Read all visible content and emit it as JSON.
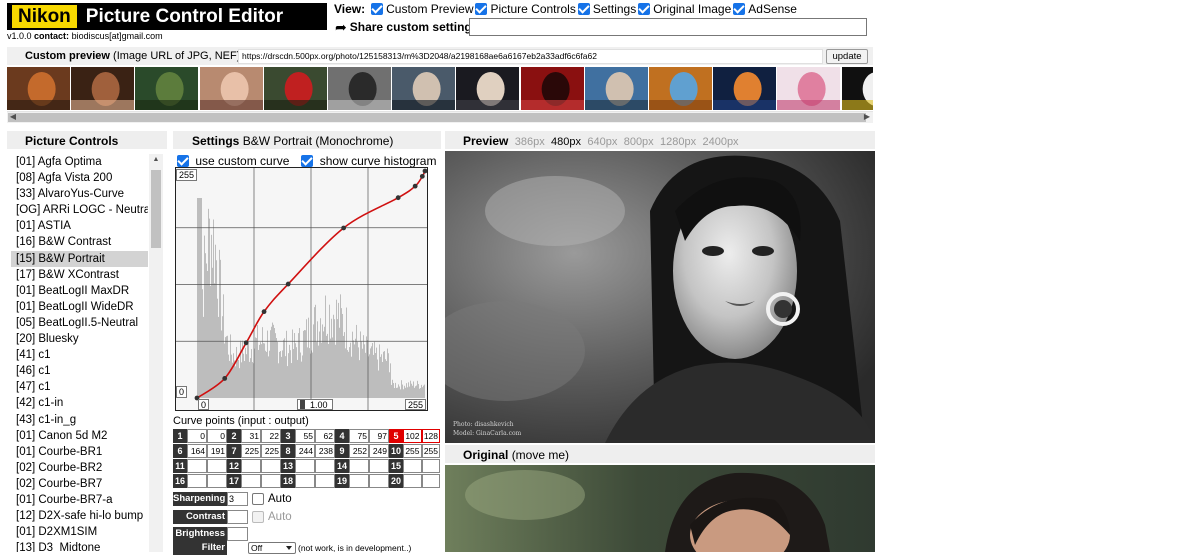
{
  "app": {
    "brand": "Nikon",
    "title": "Picture Control Editor",
    "version": "v1.0.0",
    "contact_label": "contact:",
    "contact": "biodiscus[at]gmail.com"
  },
  "view": {
    "label": "View:",
    "options": [
      {
        "label": "Custom Preview",
        "checked": true
      },
      {
        "label": "Picture Controls",
        "checked": true
      },
      {
        "label": "Settings",
        "checked": true
      },
      {
        "label": "Original Image",
        "checked": true
      },
      {
        "label": "AdSense",
        "checked": true
      }
    ],
    "share_label": "Share custom settings",
    "share_value": ""
  },
  "custom_preview": {
    "title": "Custom preview",
    "hint": "(Image URL of JPG, NEF)",
    "url": "https://drscdn.500px.org/photo/125158313/m%3D2048/a2198168ae6a6167eb2a33adf6c6fa62",
    "update_label": "update"
  },
  "picture_controls": {
    "title": "Picture Controls",
    "items": [
      "[01] Agfa Optima",
      "[08] Agfa Vista 200",
      "[33] AlvaroYus-Curve",
      "[OG] ARRi LOGC - Neutral",
      "[01] ASTIA",
      "[16] B&W Contrast",
      "[15] B&W Portrait",
      "[17] B&W XContrast",
      "[01] BeatLogII MaxDR",
      "[01] BeatLogII WideDR",
      "[05] BeatLogII.5-Neutral",
      "[20] Bluesky",
      "[41] c1",
      "[46] c1",
      "[47] c1",
      "[42] c1-in",
      "[43] c1-in_g",
      "[01] Canon 5d M2",
      "[01] Courbe-BR1",
      "[02] Courbe-BR2",
      "[02] Courbe-BR7",
      "[01] Courbe-BR7-a",
      "[12] D2X-safe hi-lo bump",
      "[01] D2XM1SIM",
      "[13] D3_Midtone"
    ],
    "selected_index": 6
  },
  "settings": {
    "title": "Settings",
    "profile": "B&W Portrait",
    "profile_type": "(Monochrome)",
    "use_custom_curve": "use custom curve",
    "show_histogram": "show curve histogram",
    "label_max": "255",
    "label_min": "0",
    "input_min": "0",
    "gamma": "1.00",
    "input_max": "255",
    "curve_points_title": "Curve points (input : output)",
    "points": [
      {
        "n": "1",
        "in": "0",
        "out": "0"
      },
      {
        "n": "2",
        "in": "31",
        "out": "22"
      },
      {
        "n": "3",
        "in": "55",
        "out": "62"
      },
      {
        "n": "4",
        "in": "75",
        "out": "97"
      },
      {
        "n": "5",
        "in": "102",
        "out": "128"
      },
      {
        "n": "6",
        "in": "164",
        "out": "191"
      },
      {
        "n": "7",
        "in": "225",
        "out": "225"
      },
      {
        "n": "8",
        "in": "244",
        "out": "238"
      },
      {
        "n": "9",
        "in": "252",
        "out": "249"
      },
      {
        "n": "10",
        "in": "255",
        "out": "255"
      },
      {
        "n": "11",
        "in": "",
        "out": ""
      },
      {
        "n": "12",
        "in": "",
        "out": ""
      },
      {
        "n": "13",
        "in": "",
        "out": ""
      },
      {
        "n": "14",
        "in": "",
        "out": ""
      },
      {
        "n": "15",
        "in": "",
        "out": ""
      },
      {
        "n": "16",
        "in": "",
        "out": ""
      },
      {
        "n": "17",
        "in": "",
        "out": ""
      },
      {
        "n": "18",
        "in": "",
        "out": ""
      },
      {
        "n": "19",
        "in": "",
        "out": ""
      },
      {
        "n": "20",
        "in": "",
        "out": ""
      }
    ],
    "selected_point": "5",
    "sharpening_label": "Sharpening",
    "sharpening_value": "3",
    "contrast_label": "Contrast",
    "contrast_value": "",
    "brightness_label": "Brightness",
    "brightness_value": "",
    "auto_label": "Auto",
    "filter_label": "Filter",
    "filter_value": "Off",
    "filter_note": "(not work, is in development..)"
  },
  "preview": {
    "title": "Preview",
    "sizes": [
      "386px",
      "480px",
      "640px",
      "800px",
      "1280px",
      "2400px"
    ],
    "active_size": "480px",
    "watermark_line1": "Photo: disashkevich",
    "watermark_line2": "Model: GinaCarla.com"
  },
  "original": {
    "title": "Original",
    "hint": "(move me)"
  },
  "colors": {
    "brand_yellow": "#f7d800",
    "checkbox_blue": "#1673e8",
    "curve_red": "#d01010",
    "point_red": "#e00000"
  }
}
